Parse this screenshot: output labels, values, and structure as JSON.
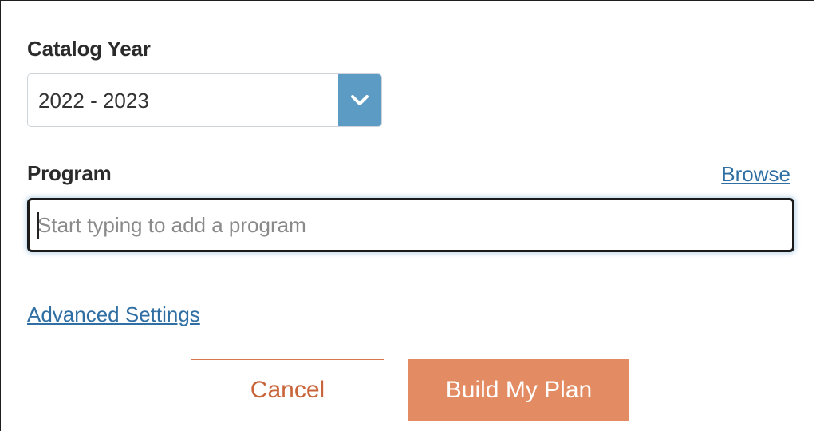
{
  "catalog": {
    "label": "Catalog Year",
    "selected": "2022 - 2023"
  },
  "program": {
    "label": "Program",
    "browse_label": "Browse",
    "placeholder": "Start typing to add a program",
    "value": ""
  },
  "advanced": {
    "label": "Advanced Settings"
  },
  "actions": {
    "cancel_label": "Cancel",
    "build_label": "Build My Plan"
  },
  "colors": {
    "accent": "#e38b62",
    "select_arrow_bg": "#5b9bc4",
    "link": "#2f6fa3"
  },
  "icons": {
    "select_arrow": "chevron-down-icon"
  }
}
